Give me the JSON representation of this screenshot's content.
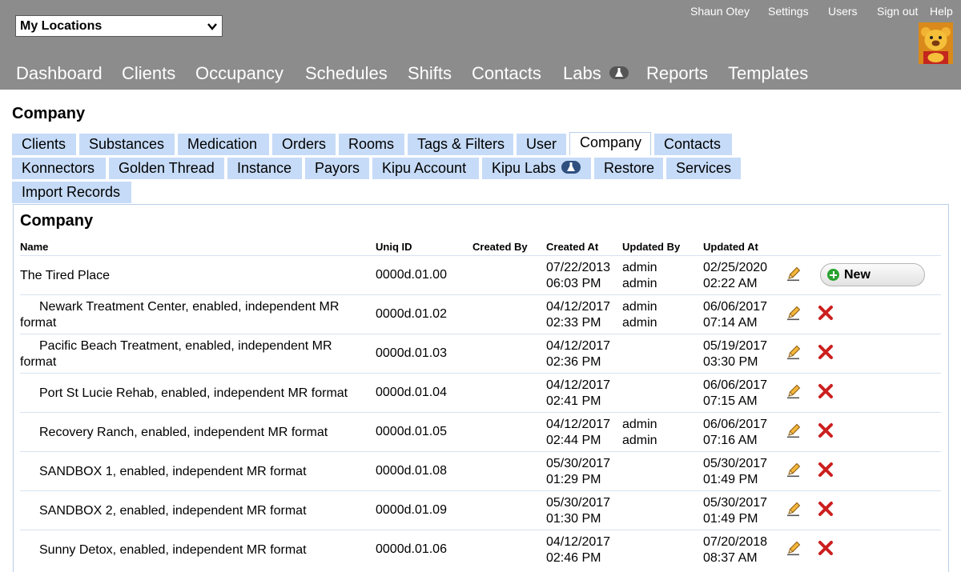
{
  "header": {
    "location_select": "My Locations",
    "top_links": {
      "user": "Shaun Otey",
      "settings": "Settings",
      "users": "Users",
      "sign_out": "Sign out",
      "help": "Help"
    },
    "nav": {
      "dashboard": "Dashboard",
      "clients": "Clients",
      "occupancy": "Occupancy",
      "schedules": "Schedules",
      "shifts": "Shifts",
      "contacts": "Contacts",
      "labs": "Labs",
      "reports": "Reports",
      "templates": "Templates"
    }
  },
  "page_title": "Company",
  "tabs": {
    "clients": "Clients",
    "substances": "Substances",
    "medication": "Medication",
    "orders": "Orders",
    "rooms": "Rooms",
    "tags_filters": "Tags & Filters",
    "user": "User",
    "company": "Company",
    "contacts": "Contacts",
    "konnectors": "Konnectors",
    "golden_thread": "Golden Thread",
    "instance": "Instance",
    "payors": "Payors",
    "kipu_account": "Kipu Account",
    "kipu_labs": "Kipu Labs",
    "restore": "Restore",
    "services": "Services",
    "import_records": "Import Records"
  },
  "panel_title": "Company",
  "table": {
    "headers": {
      "name": "Name",
      "uniq_id": "Uniq ID",
      "created_by": "Created By",
      "created_at": "Created At",
      "updated_by": "Updated By",
      "updated_at": "Updated At"
    },
    "new_button": "New",
    "rows": [
      {
        "name": "The Tired Place",
        "uid": "0000d.01.00",
        "created_date": "07/22/2013",
        "created_time": "06:03 PM",
        "updated_by_1": "admin",
        "updated_by_2": "admin",
        "updated_date": "02/25/2020",
        "updated_time": "02:22 AM"
      },
      {
        "name": "Newark Treatment Center, enabled, independent MR format",
        "uid": "0000d.01.02",
        "created_date": "04/12/2017",
        "created_time": "02:33 PM",
        "updated_by_1": "admin",
        "updated_by_2": "admin",
        "updated_date": "06/06/2017",
        "updated_time": "07:14 AM"
      },
      {
        "name": "Pacific Beach Treatment, enabled, independent MR format",
        "uid": "0000d.01.03",
        "created_date": "04/12/2017",
        "created_time": "02:36 PM",
        "updated_by_1": "",
        "updated_by_2": "",
        "updated_date": "05/19/2017",
        "updated_time": "03:30 PM"
      },
      {
        "name": "Port St Lucie Rehab, enabled, independent MR format",
        "uid": "0000d.01.04",
        "created_date": "04/12/2017",
        "created_time": "02:41 PM",
        "updated_by_1": "",
        "updated_by_2": "",
        "updated_date": "06/06/2017",
        "updated_time": "07:15 AM"
      },
      {
        "name": "Recovery Ranch, enabled, independent MR format",
        "uid": "0000d.01.05",
        "created_date": "04/12/2017",
        "created_time": "02:44 PM",
        "updated_by_1": "admin",
        "updated_by_2": "admin",
        "updated_date": "06/06/2017",
        "updated_time": "07:16 AM"
      },
      {
        "name": "SANDBOX 1, enabled, independent MR format",
        "uid": "0000d.01.08",
        "created_date": "05/30/2017",
        "created_time": "01:29 PM",
        "updated_by_1": "",
        "updated_by_2": "",
        "updated_date": "05/30/2017",
        "updated_time": "01:49 PM"
      },
      {
        "name": "SANDBOX 2, enabled, independent MR format",
        "uid": "0000d.01.09",
        "created_date": "05/30/2017",
        "created_time": "01:30 PM",
        "updated_by_1": "",
        "updated_by_2": "",
        "updated_date": "05/30/2017",
        "updated_time": "01:49 PM"
      },
      {
        "name": "Sunny Detox, enabled, independent MR format",
        "uid": "0000d.01.06",
        "created_date": "04/12/2017",
        "created_time": "02:46 PM",
        "updated_by_1": "",
        "updated_by_2": "",
        "updated_date": "07/20/2018",
        "updated_time": "08:37 AM"
      }
    ]
  },
  "colors": {
    "header_bg": "#8c8c8c",
    "tab_bg": "#c6dbf7",
    "delete_red": "#cc1f1f",
    "new_plus_green": "#27a22e"
  }
}
